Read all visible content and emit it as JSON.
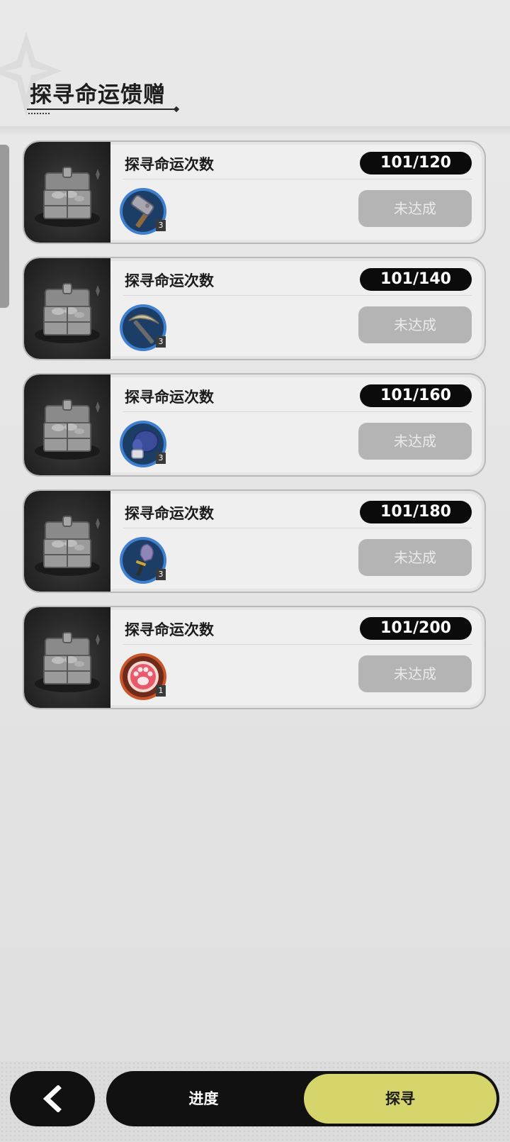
{
  "header": {
    "title": "探寻命运馈赠"
  },
  "cards": [
    {
      "label": "探寻命运次数",
      "progress": "101/120",
      "status": "未达成",
      "item": {
        "icon": "hammer-icon",
        "qty": "3",
        "ring": "#3f7fd0"
      }
    },
    {
      "label": "探寻命运次数",
      "progress": "101/140",
      "status": "未达成",
      "item": {
        "icon": "pickaxe-icon",
        "qty": "3",
        "ring": "#3f7fd0"
      }
    },
    {
      "label": "探寻命运次数",
      "progress": "101/160",
      "status": "未达成",
      "item": {
        "icon": "glove-icon",
        "qty": "3",
        "ring": "#3f7fd0"
      }
    },
    {
      "label": "探寻命运次数",
      "progress": "101/180",
      "status": "未达成",
      "item": {
        "icon": "shovel-icon",
        "qty": "3",
        "ring": "#3f7fd0"
      }
    },
    {
      "label": "探寻命运次数",
      "progress": "101/200",
      "status": "未达成",
      "item": {
        "icon": "paw-icon",
        "qty": "1",
        "ring": "#c8562a"
      }
    }
  ],
  "bottom": {
    "back_icon": "chevron-left-icon",
    "tabs": [
      {
        "label": "进度",
        "active": false
      },
      {
        "label": "探寻",
        "active": true
      }
    ],
    "accent": "#d5d56c"
  }
}
